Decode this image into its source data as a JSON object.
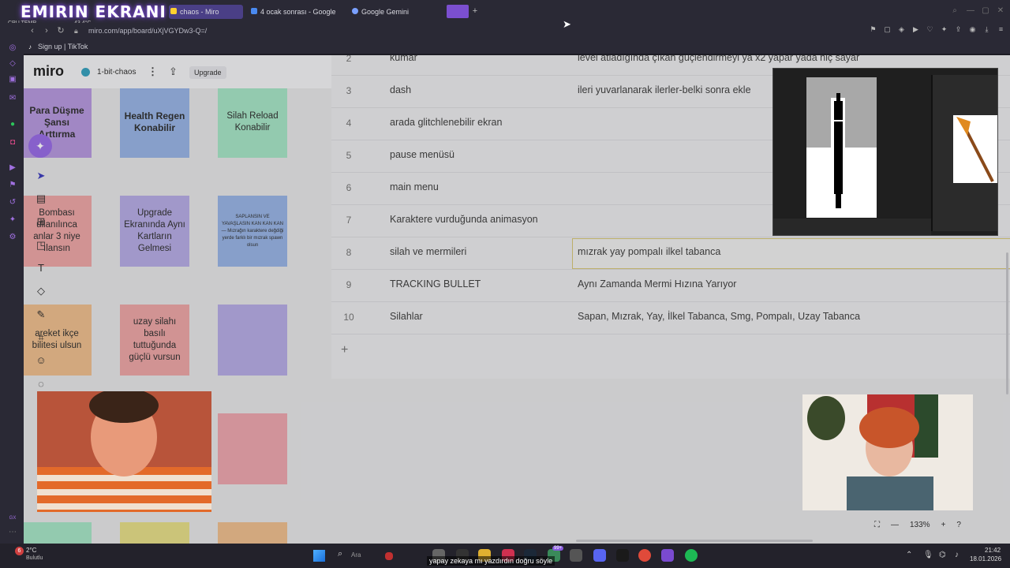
{
  "overlay": {
    "title": "EMIRIN EKRANI",
    "cpu_label": "CPU TEMP",
    "cpu_value": "43.4°C"
  },
  "browser": {
    "tabs": [
      {
        "label": "chaos - Miro",
        "active": true
      },
      {
        "label": "4 ocak sonrası - Google D",
        "active": false
      },
      {
        "label": "Google Gemini",
        "active": false
      }
    ],
    "url": "miro.com/app/board/uXjVGYDw3-Q=/",
    "bookmark": "Sign up | TikTok"
  },
  "miro": {
    "logo": "miro",
    "board_name": "1-bit-chaos",
    "upgrade_label": "Upgrade",
    "stickies": [
      {
        "text": "Para Düşme Şansı Arttırma",
        "color": "#b89ae0"
      },
      {
        "text": "Health Regen Konabilir",
        "color": "#9ab6e6"
      },
      {
        "text": "Silah Reload Konabilir",
        "color": "#a8e6c8"
      },
      {
        "text": "Bombası ullanılınca anlar 3 niye ılansın",
        "color": "#eea8a8"
      },
      {
        "text": "Upgrade Ekranında Aynı Kartların Gelmesi",
        "color": "#b8aee6"
      },
      {
        "text": "SAPLANSIN VE YAVAŞLASIN KAN KAN KAN — Mızrağın karaktere değdiği yerde farklı bir mızrak spawn olsun",
        "color": "#9ab6e6"
      },
      {
        "text": "areket ikçe bilitesi ulsun",
        "color": "#f0c090"
      },
      {
        "text": "uzay silahı basılı tuttuğunda güçlü vursun",
        "color": "#eea8a8"
      },
      {
        "text": "",
        "color": "#b8aee6"
      },
      {
        "text": "",
        "color": "#eea8b0"
      }
    ],
    "table_rows": [
      {
        "num": "2",
        "name": "kumar",
        "desc": "level atladığında çıkan güçlendirmeyi ya x2 yapar yada hiç sayar"
      },
      {
        "num": "3",
        "name": "dash",
        "desc": "ileri yuvarlanarak ilerler-belki sonra ekle"
      },
      {
        "num": "4",
        "name": "arada glitchlenebilir ekran",
        "desc": ""
      },
      {
        "num": "5",
        "name": "pause menüsü",
        "desc": ""
      },
      {
        "num": "6",
        "name": "main menu",
        "desc": ""
      },
      {
        "num": "7",
        "name": "Karaktere vurduğunda animasyon",
        "desc": ""
      },
      {
        "num": "8",
        "name": "silah ve mermileri",
        "desc": "mızrak yay pompalı ilkel tabanca"
      },
      {
        "num": "9",
        "name": "TRACKING BULLET",
        "desc": "Aynı Zamanda Mermi Hızına Yarıyor"
      },
      {
        "num": "10",
        "name": "Silahlar",
        "desc": "Sapan, Mızrak, Yay, İlkel Tabanca, Smg, Pompalı, Uzay Tabanca"
      }
    ],
    "zoom": "133%"
  },
  "taskbar": {
    "weather_temp": "2°C",
    "weather_cond": "Bulutlu",
    "weather_badge": "6",
    "search_placeholder": "Ara",
    "subtitle": "yapay zekaya mı yazdırdın doğru söyle",
    "badge": "99+",
    "time": "21:42",
    "date": "18.01.2026"
  },
  "colors": {
    "accent": "#8a5ae0",
    "miro_bg": "#e7e7e9",
    "chrome": "#2a2935"
  }
}
